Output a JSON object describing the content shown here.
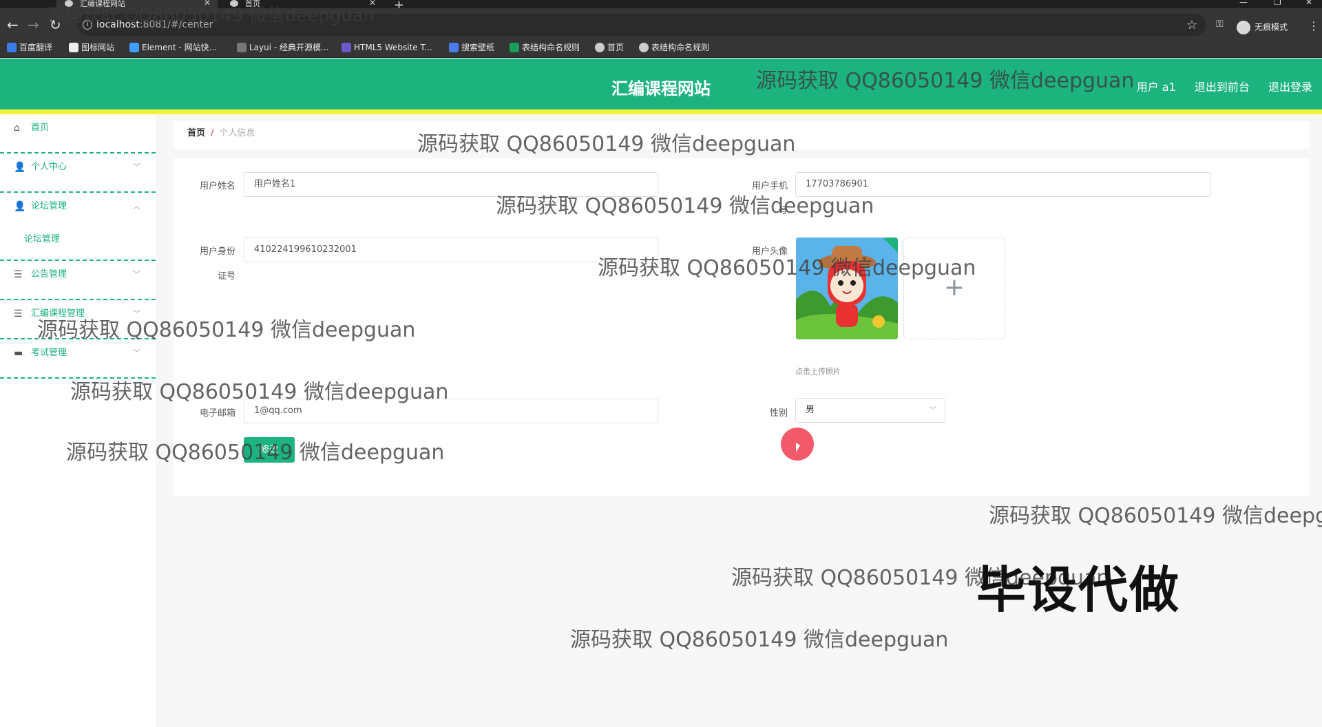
{
  "browser": {
    "tabs": [
      {
        "label": "汇编课程网站",
        "active": true
      },
      {
        "label": "首页",
        "active": false
      }
    ],
    "url_host": "localhost",
    "url_rest": ":8081/#/center",
    "incognito_label": "无痕模式",
    "bookmarks": [
      "百度翻译",
      "图标网站",
      "Element - 网站快...",
      "Layui - 经典开源模...",
      "HTML5 Website T...",
      "搜索壁纸",
      "表结构命名规则",
      "首页",
      "表结构命名规则"
    ]
  },
  "header": {
    "brand": "汇编课程网站",
    "user_label": "用户 a1",
    "back_front": "退出到前台",
    "logout": "退出登录"
  },
  "sidebar": {
    "items": [
      {
        "label": "首页"
      },
      {
        "label": "个人中心"
      },
      {
        "label": "论坛管理"
      },
      {
        "label": "论坛管理"
      },
      {
        "label": "公告管理"
      },
      {
        "label": "汇编课程管理"
      },
      {
        "label": "考试管理"
      }
    ]
  },
  "breadcrumb": {
    "home": "首页",
    "sep": "/",
    "current": "个人信息"
  },
  "form": {
    "name_label": "用户姓名",
    "name_value": "用户姓名1",
    "phone_label_1": "用户手机",
    "phone_label_2": "号",
    "phone_value": "17703786901",
    "id_label_1": "用户身份",
    "id_label_2": "证号",
    "id_value": "410224199610232001",
    "avatar_label": "用户头像",
    "upload_hint": "点击上传照片",
    "email_label": "电子邮箱",
    "email_value": "1@qq.com",
    "gender_label": "性别",
    "gender_value": "男",
    "submit_label": "修改"
  },
  "watermarks": {
    "text": "源码获取 QQ86050149 微信deepguan",
    "big": "毕设代做"
  }
}
